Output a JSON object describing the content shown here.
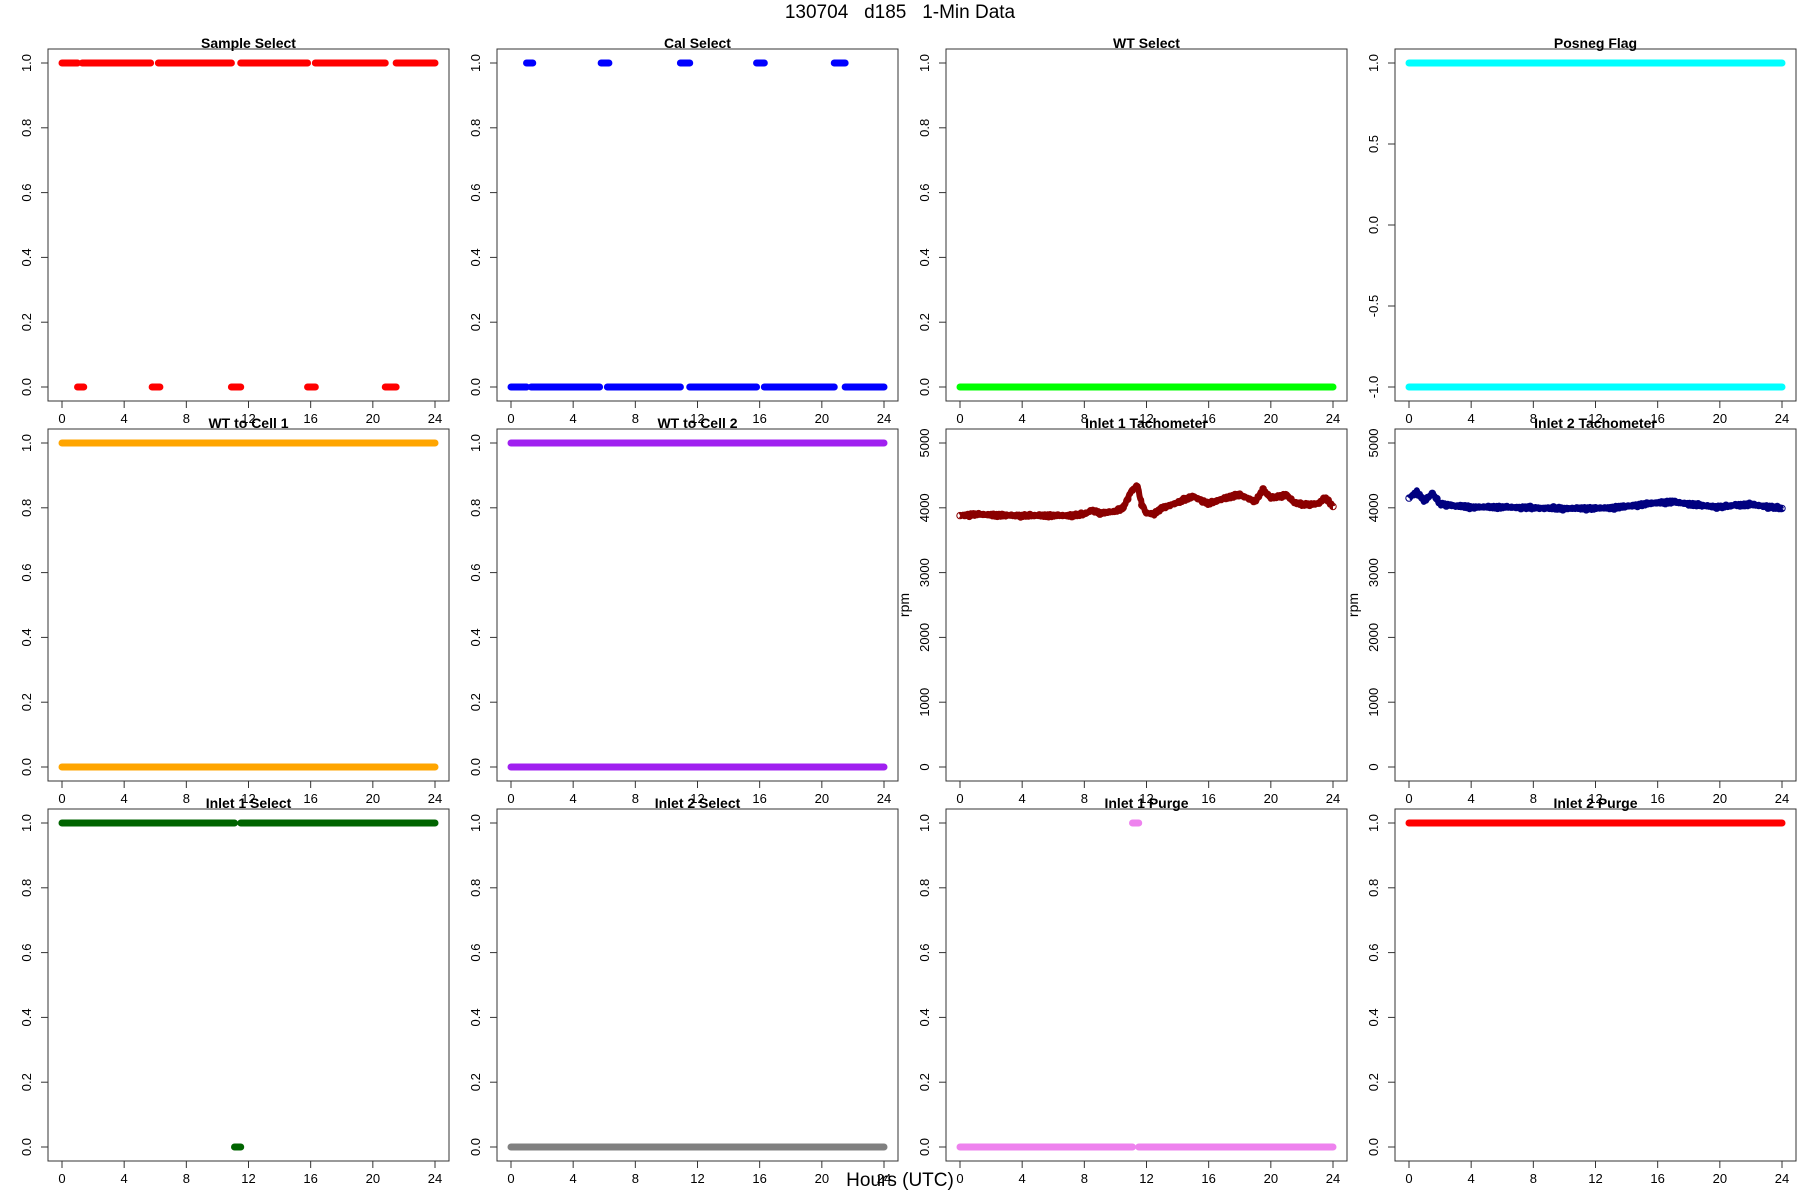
{
  "page": {
    "title": "130704   d185   1-Min Data",
    "xlabel": "Hours (UTC)"
  },
  "chart_data": [
    {
      "type": "scatter",
      "title": "Sample Select",
      "color": "#ff0000",
      "ylim": [
        0,
        1
      ],
      "yticks": [
        "0.0",
        "0.2",
        "0.4",
        "0.6",
        "0.8",
        "1.0"
      ],
      "ylabel": "",
      "xlim": [
        0,
        24
      ],
      "xticks": [
        0,
        4,
        8,
        12,
        16,
        20,
        24
      ],
      "segments": [
        {
          "y": 1,
          "x": [
            [
              0,
              1.0
            ],
            [
              1.3,
              5.7
            ],
            [
              6.2,
              10.9
            ],
            [
              11.5,
              15.8
            ],
            [
              16.3,
              20.8
            ],
            [
              21.5,
              24
            ]
          ]
        },
        {
          "y": 0,
          "x": [
            [
              1.0,
              1.4
            ],
            [
              5.8,
              6.3
            ],
            [
              10.9,
              11.5
            ],
            [
              15.8,
              16.3
            ],
            [
              20.8,
              21.5
            ]
          ]
        }
      ]
    },
    {
      "type": "scatter",
      "title": "Cal Select",
      "color": "#0000ff",
      "ylim": [
        0,
        1
      ],
      "yticks": [
        "0.0",
        "0.2",
        "0.4",
        "0.6",
        "0.8",
        "1.0"
      ],
      "ylabel": "",
      "xlim": [
        0,
        24
      ],
      "xticks": [
        0,
        4,
        8,
        12,
        16,
        20,
        24
      ],
      "segments": [
        {
          "y": 1,
          "x": [
            [
              1.0,
              1.4
            ],
            [
              5.8,
              6.3
            ],
            [
              10.9,
              11.5
            ],
            [
              15.8,
              16.3
            ],
            [
              20.8,
              21.5
            ]
          ]
        },
        {
          "y": 0,
          "x": [
            [
              0,
              1.0
            ],
            [
              1.3,
              5.7
            ],
            [
              6.2,
              10.9
            ],
            [
              11.5,
              15.8
            ],
            [
              16.3,
              20.8
            ],
            [
              21.5,
              24
            ]
          ]
        }
      ]
    },
    {
      "type": "scatter",
      "title": "WT Select",
      "color": "#00ff00",
      "ylim": [
        0,
        1
      ],
      "yticks": [
        "0.0",
        "0.2",
        "0.4",
        "0.6",
        "0.8",
        "1.0"
      ],
      "ylabel": "",
      "xlim": [
        0,
        24
      ],
      "xticks": [
        0,
        4,
        8,
        12,
        16,
        20,
        24
      ],
      "segments": [
        {
          "y": 0,
          "x": [
            [
              0,
              24
            ]
          ]
        }
      ]
    },
    {
      "type": "scatter",
      "title": "Posneg Flag",
      "color": "#00ffff",
      "ylim": [
        -1,
        1
      ],
      "yticks": [
        "-1.0",
        "-0.5",
        "0.0",
        "0.5",
        "1.0"
      ],
      "ylabel": "",
      "xlim": [
        0,
        24
      ],
      "xticks": [
        0,
        4,
        8,
        12,
        16,
        20,
        24
      ],
      "segments": [
        {
          "y": 1,
          "x": [
            [
              0,
              24
            ]
          ]
        },
        {
          "y": -1,
          "x": [
            [
              0,
              24
            ]
          ]
        }
      ]
    },
    {
      "type": "scatter",
      "title": "WT to Cell 1",
      "color": "#ffa500",
      "ylim": [
        0,
        1
      ],
      "yticks": [
        "0.0",
        "0.2",
        "0.4",
        "0.6",
        "0.8",
        "1.0"
      ],
      "ylabel": "",
      "xlim": [
        0,
        24
      ],
      "xticks": [
        0,
        4,
        8,
        12,
        16,
        20,
        24
      ],
      "segments": [
        {
          "y": 1,
          "x": [
            [
              0,
              24
            ]
          ]
        },
        {
          "y": 0,
          "x": [
            [
              0,
              24
            ]
          ]
        }
      ]
    },
    {
      "type": "scatter",
      "title": "WT to Cell 2",
      "color": "#a020f0",
      "ylim": [
        0,
        1
      ],
      "yticks": [
        "0.0",
        "0.2",
        "0.4",
        "0.6",
        "0.8",
        "1.0"
      ],
      "ylabel": "",
      "xlim": [
        0,
        24
      ],
      "xticks": [
        0,
        4,
        8,
        12,
        16,
        20,
        24
      ],
      "segments": [
        {
          "y": 1,
          "x": [
            [
              0,
              24
            ]
          ]
        },
        {
          "y": 0,
          "x": [
            [
              0,
              24
            ]
          ]
        }
      ]
    },
    {
      "type": "scatter",
      "title": "Inlet 1 Tachometer",
      "color": "#8b0000",
      "ylim": [
        0,
        5000
      ],
      "yticks": [
        "0",
        "1000",
        "2000",
        "3000",
        "4000",
        "5000"
      ],
      "ylabel": "rpm",
      "xlim": [
        0,
        24
      ],
      "xticks": [
        0,
        4,
        8,
        12,
        16,
        20,
        24
      ],
      "line": [
        [
          0,
          3880
        ],
        [
          0.5,
          3890
        ],
        [
          1,
          3900
        ],
        [
          2,
          3890
        ],
        [
          3,
          3880
        ],
        [
          4,
          3880
        ],
        [
          5,
          3880
        ],
        [
          6,
          3880
        ],
        [
          7,
          3880
        ],
        [
          8,
          3900
        ],
        [
          8.5,
          3960
        ],
        [
          9,
          3920
        ],
        [
          10,
          3940
        ],
        [
          10.5,
          4000
        ],
        [
          11,
          4250
        ],
        [
          11.4,
          4350
        ],
        [
          11.7,
          4050
        ],
        [
          12,
          3920
        ],
        [
          12.5,
          3900
        ],
        [
          13,
          4000
        ],
        [
          14,
          4080
        ],
        [
          15,
          4180
        ],
        [
          15.5,
          4120
        ],
        [
          16,
          4060
        ],
        [
          17,
          4150
        ],
        [
          18,
          4200
        ],
        [
          19,
          4100
        ],
        [
          19.5,
          4280
        ],
        [
          20,
          4150
        ],
        [
          21,
          4200
        ],
        [
          21.5,
          4080
        ],
        [
          22,
          4050
        ],
        [
          23,
          4060
        ],
        [
          23.5,
          4150
        ],
        [
          24,
          4020
        ]
      ]
    },
    {
      "type": "scatter",
      "title": "Inlet 2 Tachometer",
      "color": "#000080",
      "ylim": [
        0,
        5000
      ],
      "yticks": [
        "0",
        "1000",
        "2000",
        "3000",
        "4000",
        "5000"
      ],
      "ylabel": "rpm",
      "xlim": [
        0,
        24
      ],
      "xticks": [
        0,
        4,
        8,
        12,
        16,
        20,
        24
      ],
      "line": [
        [
          0,
          4150
        ],
        [
          0.5,
          4250
        ],
        [
          1,
          4100
        ],
        [
          1.5,
          4220
        ],
        [
          2,
          4060
        ],
        [
          3,
          4030
        ],
        [
          4,
          4010
        ],
        [
          6,
          4010
        ],
        [
          8,
          4000
        ],
        [
          10,
          3990
        ],
        [
          12,
          3990
        ],
        [
          13,
          4000
        ],
        [
          14,
          4020
        ],
        [
          15,
          4050
        ],
        [
          16,
          4080
        ],
        [
          17,
          4090
        ],
        [
          18,
          4060
        ],
        [
          19,
          4030
        ],
        [
          20,
          4010
        ],
        [
          21,
          4040
        ],
        [
          22,
          4050
        ],
        [
          23,
          4020
        ],
        [
          24,
          3990
        ]
      ]
    },
    {
      "type": "scatter",
      "title": "Inlet 1 Select",
      "color": "#006400",
      "ylim": [
        0,
        1
      ],
      "yticks": [
        "0.0",
        "0.2",
        "0.4",
        "0.6",
        "0.8",
        "1.0"
      ],
      "ylabel": "",
      "xlim": [
        0,
        24
      ],
      "xticks": [
        0,
        4,
        8,
        12,
        16,
        20,
        24
      ],
      "segments": [
        {
          "y": 1,
          "x": [
            [
              0,
              11.1
            ],
            [
              11.5,
              24
            ]
          ]
        },
        {
          "y": 0,
          "x": [
            [
              11.1,
              11.5
            ]
          ]
        }
      ]
    },
    {
      "type": "scatter",
      "title": "Inlet 2 Select",
      "color": "#808080",
      "ylim": [
        0,
        1
      ],
      "yticks": [
        "0.0",
        "0.2",
        "0.4",
        "0.6",
        "0.8",
        "1.0"
      ],
      "ylabel": "",
      "xlim": [
        0,
        24
      ],
      "xticks": [
        0,
        4,
        8,
        12,
        16,
        20,
        24
      ],
      "segments": [
        {
          "y": 0,
          "x": [
            [
              0,
              24
            ]
          ]
        }
      ]
    },
    {
      "type": "scatter",
      "title": "Inlet 1 Purge",
      "color": "#ee82ee",
      "ylim": [
        0,
        1
      ],
      "yticks": [
        "0.0",
        "0.2",
        "0.4",
        "0.6",
        "0.8",
        "1.0"
      ],
      "ylabel": "",
      "xlim": [
        0,
        24
      ],
      "xticks": [
        0,
        4,
        8,
        12,
        16,
        20,
        24
      ],
      "segments": [
        {
          "y": 0,
          "x": [
            [
              0,
              11.1
            ],
            [
              11.5,
              24
            ]
          ]
        },
        {
          "y": 1,
          "x": [
            [
              11.1,
              11.5
            ]
          ]
        }
      ]
    },
    {
      "type": "scatter",
      "title": "Inlet 2 Purge",
      "color": "#ff0000",
      "ylim": [
        0,
        1
      ],
      "yticks": [
        "0.0",
        "0.2",
        "0.4",
        "0.6",
        "0.8",
        "1.0"
      ],
      "ylabel": "",
      "xlim": [
        0,
        24
      ],
      "xticks": [
        0,
        4,
        8,
        12,
        16,
        20,
        24
      ],
      "segments": [
        {
          "y": 1,
          "x": [
            [
              0,
              24
            ]
          ]
        }
      ]
    }
  ]
}
